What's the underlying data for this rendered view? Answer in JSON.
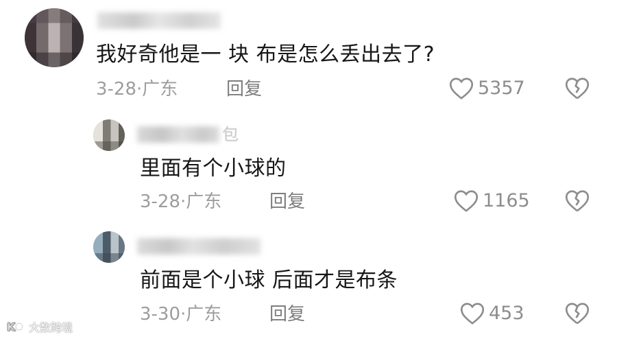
{
  "comments": [
    {
      "username_suffix": "",
      "text": "我好奇他是一 块 布是怎么丢出去了?",
      "date": "3-28",
      "location": "广东",
      "reply_label": "回复",
      "likes": "5357"
    },
    {
      "username_suffix": "包",
      "text": "里面有个小球的",
      "date": "3-28",
      "location": "广东",
      "reply_label": "回复",
      "likes": "1165"
    },
    {
      "username_suffix": "",
      "text": "前面是个小球 后面才是布条",
      "date": "3-30",
      "location": "广东",
      "reply_label": "回复",
      "likes": "453"
    }
  ],
  "meta_separator": "·",
  "watermark": {
    "logo_text": "K",
    "text": "大数跨境"
  },
  "colors": {
    "text": "#161616",
    "meta": "#9d9d9d",
    "icon": "#8d8d8d"
  },
  "icons": {
    "like": "heart-outline-icon",
    "dislike": "broken-heart-icon"
  }
}
